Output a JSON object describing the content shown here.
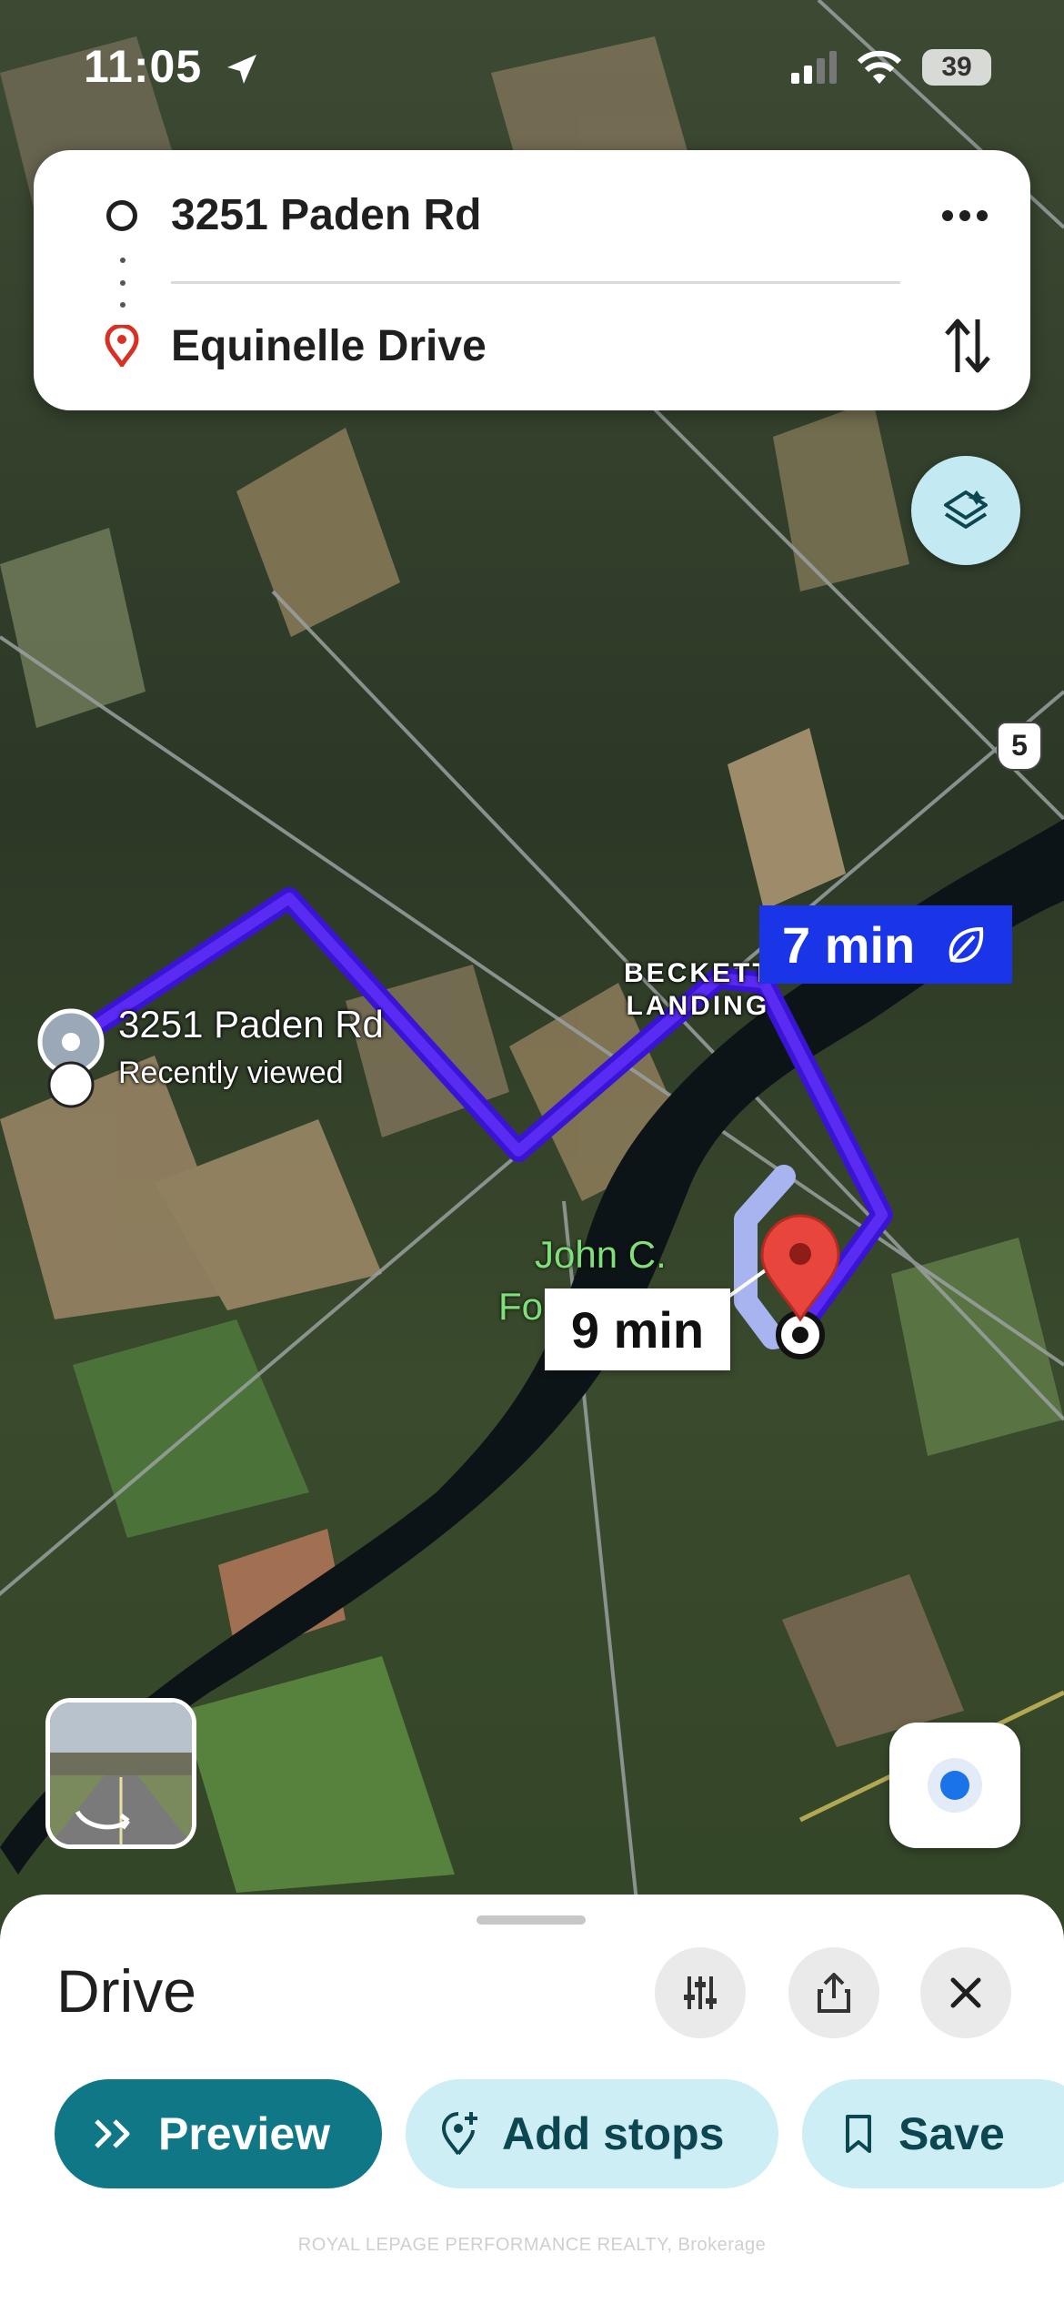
{
  "status_bar": {
    "time": "11:05",
    "battery": "39",
    "icons": [
      "location-arrow-icon",
      "cellular-signal-icon",
      "wifi-icon",
      "battery-icon"
    ]
  },
  "directions": {
    "origin": "3251 Paden Rd",
    "destination": "Equinelle Drive",
    "more_icon": "more-horizontal-icon",
    "swap_icon": "swap-vertical-icon"
  },
  "map": {
    "layers_icon": "layers-icon",
    "highway_shield": "5",
    "route_primary_time": "7 min",
    "route_primary_icon": "leaf-eco-icon",
    "route_alt_time": "9 min",
    "place_beckett_line1": "BECKETT",
    "place_beckett_line2": "LANDING",
    "origin_label": "3251 Paden Rd",
    "origin_sublabel": "Recently viewed",
    "park_label_line1": "John C.",
    "park_label_line2": "Fo",
    "route_color": "#4a18e0",
    "alt_route_color": "#a8b4f0",
    "destination_pin_color": "#e8453c"
  },
  "sheet": {
    "title": "Drive",
    "buttons": {
      "options_icon": "sliders-icon",
      "share_icon": "share-icon",
      "close_icon": "close-icon"
    },
    "actions": {
      "preview": "Preview",
      "add_stops": "Add stops",
      "save": "Save"
    }
  },
  "watermark": "ROYAL LEPAGE PERFORMANCE REALTY, Brokerage",
  "colors": {
    "accent_teal": "#107786",
    "light_teal": "#cdeef5",
    "route_blue_label": "#1a35e8"
  }
}
